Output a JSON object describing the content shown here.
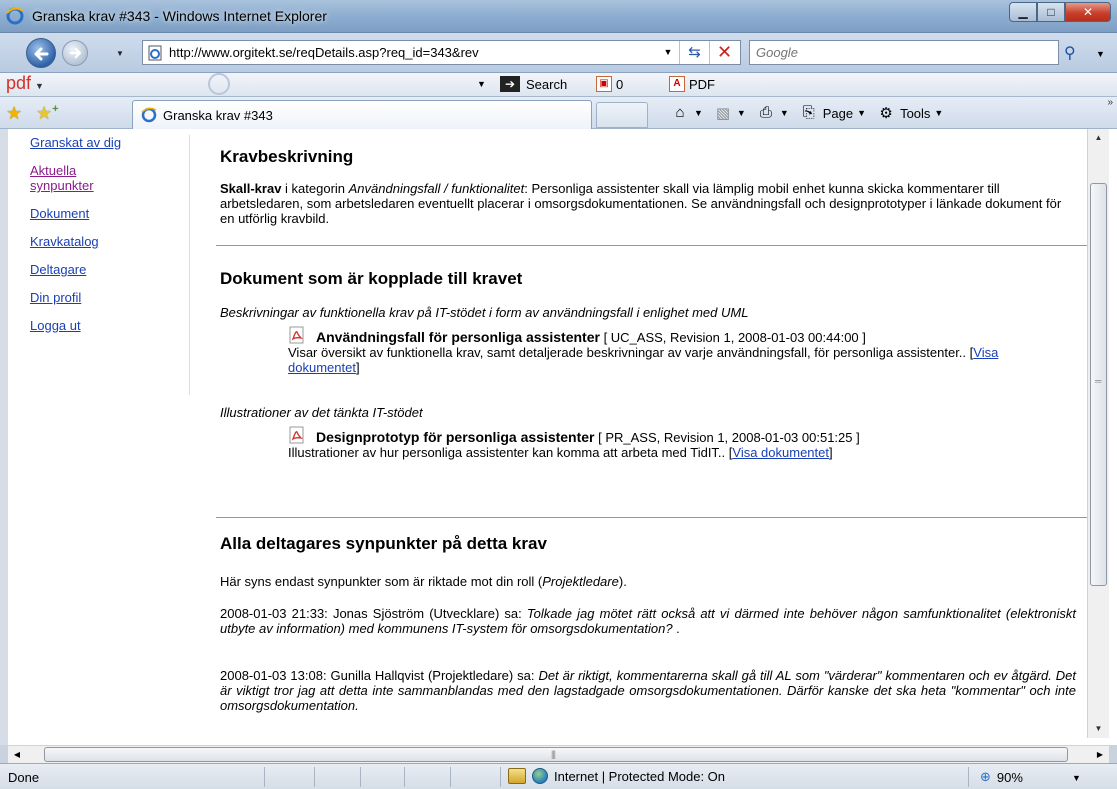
{
  "window": {
    "title": "Granska krav #343 - Windows Internet Explorer"
  },
  "address": {
    "url": "http://www.orgitekt.se/reqDetails.asp?req_id=343&rev",
    "search_placeholder": "Google"
  },
  "toolbar2": {
    "brand": "pdf",
    "search_label": "Search",
    "count": "0",
    "pdf_label": "PDF"
  },
  "tab": {
    "title": "Granska krav #343"
  },
  "commands": {
    "page_label": "Page",
    "tools_label": "Tools"
  },
  "sidebar": {
    "items": [
      {
        "label": "Granskat av dig"
      },
      {
        "label": "Aktuella synpunkter"
      },
      {
        "label": "Dokument"
      },
      {
        "label": "Kravkatalog"
      },
      {
        "label": "Deltagare"
      },
      {
        "label": "Din profil"
      },
      {
        "label": "Logga ut"
      }
    ]
  },
  "content": {
    "sec1_title": "Kravbeskrivning",
    "sec1_bold": "Skall-krav",
    "sec1_mid": " i kategorin ",
    "sec1_category": "Användningsfall / funktionalitet",
    "sec1_text": ": Personliga assistenter skall via lämplig mobil enhet kunna skicka kommentarer till arbetsledaren, som arbetsledaren eventuellt placerar i omsorgsdokumentationen. Se användningsfall och designprototyper i länkade dokument för en utförlig kravbild.",
    "sec2_title": "Dokument som är kopplade till kravet",
    "group1": "Beskrivningar av funktionella krav på IT-stödet i form av användningsfall i enlighet med UML",
    "doc1_title": "Användningsfall för personliga assistenter",
    "doc1_meta": " [ UC_ASS, Revision 1, 2008-01-03 00:44:00 ]",
    "doc1_desc": "Visar översikt av funktionella krav, samt detaljerade beskrivningar av varje användningsfall, för personliga assistenter.. ",
    "doc1_link": "Visa dokumentet",
    "group2": "Illustrationer av det tänkta IT-stödet",
    "doc2_title": "Designprototyp för personliga assistenter",
    "doc2_meta": " [ PR_ASS, Revision 1, 2008-01-03 00:51:25 ]",
    "doc2_desc": "Illustrationer av hur personliga assistenter kan komma att arbeta med TidIT.. ",
    "doc2_link": "Visa dokumentet",
    "sec3_title": "Alla deltagares synpunkter på detta krav",
    "intro_pre": "Här syns endast synpunkter som är riktade mot din roll (",
    "intro_role": "Projektledare",
    "intro_post": ").",
    "c1_meta": "2008-01-03 21:33: Jonas Sjöström (Utvecklare) sa: ",
    "c1_text": "Tolkade jag mötet rätt också att vi därmed inte behöver någon samfunktionalitet (elektroniskt utbyte av information) med kommunens IT-system för omsorgsdokumentation?",
    "c1_tail": " .",
    "c2_meta": "2008-01-03 13:08: Gunilla Hallqvist (Projektledare) sa: ",
    "c2_text": "Det är riktigt, kommentarerna skall gå till AL som \"värderar\" kommentaren och ev åtgärd. Det är viktigt tror jag att detta inte sammanblandas med den lagstadgade omsorgsdokumentationen. Därför kanske det ska heta \"kommentar\" och inte omsorgsdokumentation."
  },
  "status": {
    "left": "Done",
    "zone": "Internet | Protected Mode: On",
    "zoom": "90%"
  },
  "colors": {
    "link": "#1a3fb5",
    "visited_link": "#8b1a8b",
    "pdf_brand": "#d2322a"
  },
  "icons": [
    "ie-logo-icon",
    "back-arrow-icon",
    "forward-arrow-icon",
    "refresh-icon",
    "stop-icon",
    "search-icon",
    "favorites-star-icon",
    "add-favorites-icon",
    "home-icon",
    "feeds-icon",
    "print-icon",
    "page-icon",
    "tools-gear-icon",
    "pdf-icon",
    "lock-icon",
    "globe-icon",
    "zoom-icon"
  ]
}
